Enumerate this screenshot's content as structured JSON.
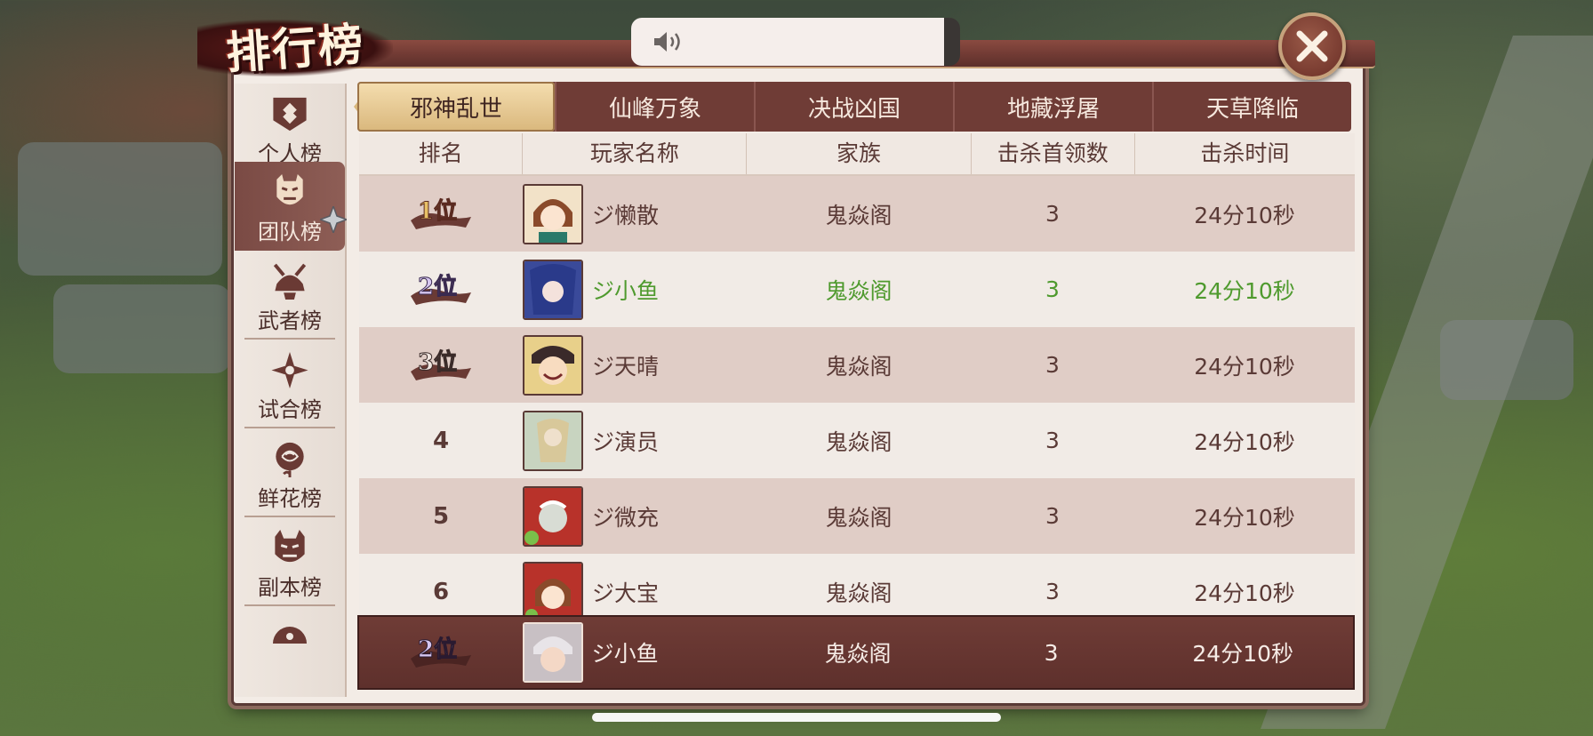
{
  "title": "排行榜",
  "notice": {
    "icon": "speaker-icon",
    "text": ""
  },
  "sidebar": {
    "items": [
      {
        "label": "个人榜",
        "icon": "shield-icon"
      },
      {
        "label": "团队榜",
        "icon": "oni-mask-icon",
        "active": true
      },
      {
        "label": "武者榜",
        "icon": "samurai-helmet-icon"
      },
      {
        "label": "试合榜",
        "icon": "shuriken-icon"
      },
      {
        "label": "鲜花榜",
        "icon": "rose-icon"
      },
      {
        "label": "副本榜",
        "icon": "demon-mask-icon"
      },
      {
        "label": "",
        "icon": "fan-icon"
      }
    ]
  },
  "tabs": [
    {
      "label": "邪神乱世",
      "active": true
    },
    {
      "label": "仙峰万象"
    },
    {
      "label": "决战凶国"
    },
    {
      "label": "地藏浮屠"
    },
    {
      "label": "天草降临"
    }
  ],
  "table": {
    "headers": [
      "排名",
      "玩家名称",
      "家族",
      "击杀首领数",
      "击杀时间"
    ],
    "rows": [
      {
        "rank": "1位",
        "badge": true,
        "name": "ジ懒散",
        "family": "鬼焱阁",
        "kills": "3",
        "time": "24分10秒"
      },
      {
        "rank": "2位",
        "badge": true,
        "name": "ジ小鱼",
        "family": "鬼焱阁",
        "kills": "3",
        "time": "24分10秒",
        "highlight": true
      },
      {
        "rank": "3位",
        "badge": true,
        "name": "ジ天晴",
        "family": "鬼焱阁",
        "kills": "3",
        "time": "24分10秒"
      },
      {
        "rank": "4",
        "name": "ジ演员",
        "family": "鬼焱阁",
        "kills": "3",
        "time": "24分10秒"
      },
      {
        "rank": "5",
        "name": "ジ微充",
        "family": "鬼焱阁",
        "kills": "3",
        "time": "24分10秒"
      },
      {
        "rank": "6",
        "name": "ジ大宝",
        "family": "鬼焱阁",
        "kills": "3",
        "time": "24分10秒"
      }
    ],
    "self": {
      "rank": "2位",
      "name": "ジ小鱼",
      "family": "鬼焱阁",
      "kills": "3",
      "time": "24分10秒"
    }
  },
  "colors": {
    "highlight_text": "#4f9a2e",
    "tab_bar": "#6f3c36",
    "active_tab": "#d9b77c"
  }
}
